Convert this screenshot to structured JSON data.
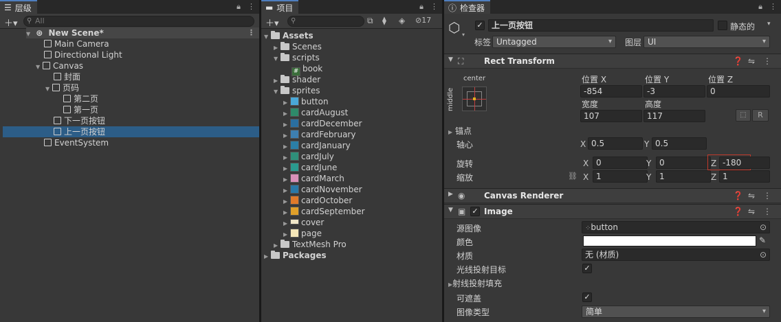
{
  "hierarchy": {
    "tab": "层级",
    "search_placeholder": "All",
    "scene": "New Scene*",
    "items": [
      {
        "label": "Main Camera"
      },
      {
        "label": "Directional Light"
      },
      {
        "label": "Canvas"
      },
      {
        "label": "封面"
      },
      {
        "label": "页码"
      },
      {
        "label": "第二页"
      },
      {
        "label": "第一页"
      },
      {
        "label": "下一页按钮"
      },
      {
        "label": "上一页按钮"
      },
      {
        "label": "EventSystem"
      }
    ]
  },
  "project": {
    "tab": "项目",
    "hidden_count": "17",
    "assets": "Assets",
    "folders": [
      "Scenes",
      "scripts",
      "shader",
      "sprites",
      "TextMesh Pro",
      "Packages"
    ],
    "script_file": "book",
    "sprites": [
      "button",
      "cardAugust",
      "cardDecember",
      "cardFebruary",
      "cardJanuary",
      "cardJuly",
      "cardJune",
      "cardMarch",
      "cardNovember",
      "cardOctober",
      "cardSeptember",
      "cover",
      "page"
    ]
  },
  "inspector": {
    "tab": "检查器",
    "object_name": "上一页按钮",
    "static_label": "静态的",
    "tag_label": "标签",
    "tag_value": "Untagged",
    "layer_label": "图层",
    "layer_value": "UI",
    "rect_transform": {
      "title": "Rect Transform",
      "anchor_h": "center",
      "anchor_v": "middle",
      "pos_x_label": "位置 X",
      "pos_y_label": "位置 Y",
      "pos_z_label": "位置 Z",
      "pos_x": "-854",
      "pos_y": "-3",
      "pos_z": "0",
      "width_label": "宽度",
      "height_label": "高度",
      "width": "107",
      "height": "117",
      "anchors_label": "锚点",
      "pivot_label": "轴心",
      "pivot_x": "0.5",
      "pivot_y": "0.5",
      "rotation_label": "旋转",
      "rot_x": "0",
      "rot_y": "0",
      "rot_z": "-180",
      "scale_label": "缩放",
      "scale_x": "1",
      "scale_y": "1",
      "scale_z": "1",
      "x": "X",
      "y": "Y",
      "z": "Z",
      "r": "R"
    },
    "canvas_renderer": {
      "title": "Canvas Renderer"
    },
    "image": {
      "title": "Image",
      "source_label": "源图像",
      "source_value": "button",
      "color_label": "颜色",
      "material_label": "材质",
      "material_value": "无 (材质)",
      "raycast_label": "光线投射目标",
      "raycast_padding_label": "射线投射填充",
      "maskable_label": "可遮盖",
      "image_type_label": "图像类型",
      "image_type_value": "简单"
    }
  },
  "colors": {
    "selection": "#2c5d87",
    "highlight_box": "#c0392b",
    "tab_accent": "#4f7fbf"
  }
}
